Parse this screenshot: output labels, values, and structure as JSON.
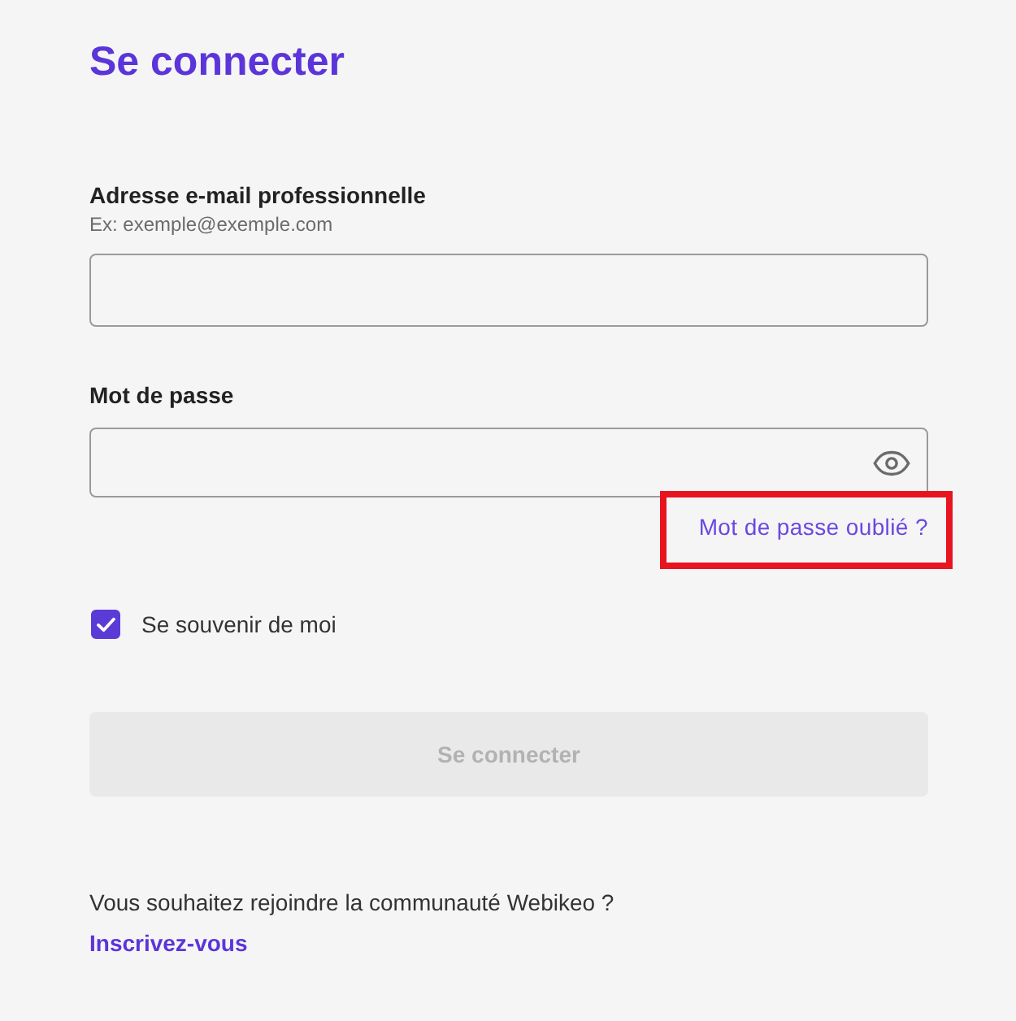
{
  "title": "Se connecter",
  "email": {
    "label": "Adresse e-mail professionnelle",
    "hint": "Ex: exemple@exemple.com"
  },
  "password": {
    "label": "Mot de passe",
    "reveal_toggle": true
  },
  "forgot_link": {
    "label": "Mot de passe oublié ?",
    "highlighted": true
  },
  "remember": {
    "label": "Se souvenir de moi",
    "checked": true
  },
  "submit": {
    "label": "Se connecter",
    "disabled": true
  },
  "signup": {
    "prompt": "Vous souhaitez rejoindre la communauté Webikeo ?",
    "link": "Inscrivez-vous"
  }
}
